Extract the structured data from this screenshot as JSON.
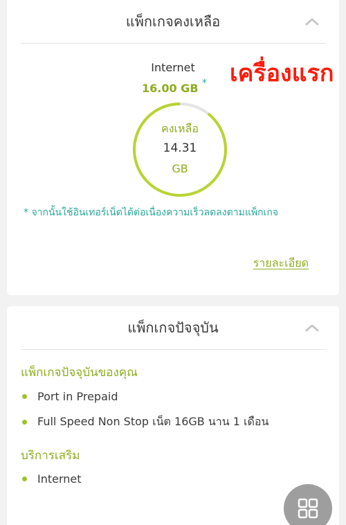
{
  "remaining_card": {
    "title": "แพ็กเกจคงเหลือ",
    "internet_label": "Internet",
    "internet_total": "16.00 GB",
    "asterisk": "*",
    "gauge_label": "คงเหลือ",
    "gauge_value": "14.31",
    "gauge_unit": "GB",
    "remaining_fraction": 0.894,
    "note": "*  จากนั้นใช้อินเทอร์เน็ตได้ต่อเนื่องความเร็วลดลงตามแพ็กเกจ",
    "details_link": "รายละเอียด",
    "overlay_text": "เครื่องแรก"
  },
  "current_card": {
    "title": "แพ็กเกจปัจจุบัน",
    "section_package": "แพ็กเกจปัจจุบันของคุณ",
    "packages": [
      "Port in Prepaid",
      "Full Speed Non Stop เน็ต 16GB นาน 1 เดือน"
    ],
    "section_addons": "บริการเสริม",
    "addons": [
      "Internet"
    ]
  },
  "colors": {
    "accent_green": "#8cad1e",
    "gauge_green": "#b7d432",
    "teal_note": "#2aa79b",
    "overlay_red": "#ff1a0a"
  },
  "icons": {
    "collapse": "chevron-up-icon",
    "menu": "grid-menu-icon"
  }
}
